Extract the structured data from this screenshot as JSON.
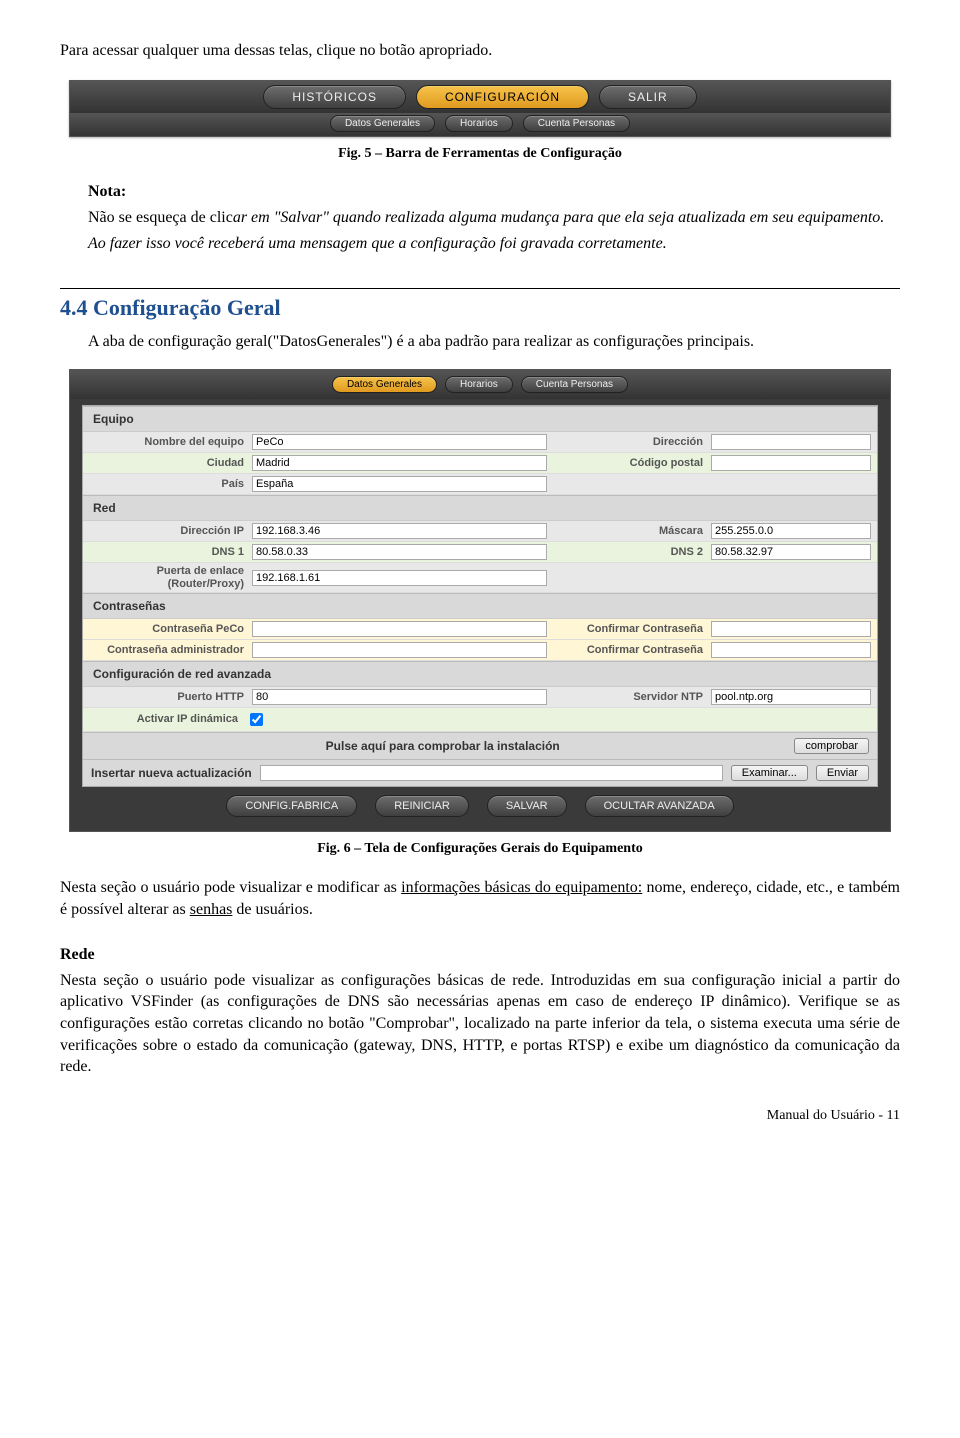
{
  "intro_text": "Para acessar qualquer uma dessas telas, clique no botão apropriado.",
  "toolbar": {
    "main_tabs": [
      "HISTÓRICOS",
      "CONFIGURACIÓN",
      "SALIR"
    ],
    "active_main": 1,
    "sub_tabs": [
      "Datos Generales",
      "Horarios",
      "Cuenta Personas"
    ]
  },
  "fig5_caption": "Fig. 5 – Barra de Ferramentas de Configuração",
  "nota": {
    "label": "Nota:",
    "line1_plain_a": "Não se esqueça de clic",
    "line1_italic_a": "ar em \"Salvar\" quando realizada alguma mudança para que ela seja atualizada em seu equipamento.",
    "line2_italic": "Ao fazer isso você receberá uma mensagem que a configuração foi gravada corretamente."
  },
  "section_44": {
    "title": "4.4  Configuração Geral",
    "para": "A aba de configuração geral(\"DatosGenerales\") é a aba padrão para realizar as configurações principais."
  },
  "config": {
    "sub_tabs": [
      "Datos Generales",
      "Horarios",
      "Cuenta Personas"
    ],
    "active_sub": 0,
    "groups": {
      "equipo": {
        "header": "Equipo",
        "nombre_label": "Nombre del equipo",
        "nombre_value": "PeCo",
        "direccion_label": "Dirección",
        "direccion_value": "",
        "ciudad_label": "Ciudad",
        "ciudad_value": "Madrid",
        "cp_label": "Código postal",
        "cp_value": "",
        "pais_label": "País",
        "pais_value": "España"
      },
      "red": {
        "header": "Red",
        "ip_label": "Dirección IP",
        "ip_value": "192.168.3.46",
        "mask_label": "Máscara",
        "mask_value": "255.255.0.0",
        "dns1_label": "DNS 1",
        "dns1_value": "80.58.0.33",
        "dns2_label": "DNS 2",
        "dns2_value": "80.58.32.97",
        "gw_label": "Puerta de enlace (Router/Proxy)",
        "gw_value": "192.168.1.61"
      },
      "contrasenas": {
        "header": "Contraseñas",
        "peco_label": "Contraseña PeCo",
        "peco_value": "",
        "peco_confirm_label": "Confirmar Contraseña",
        "peco_confirm_value": "",
        "admin_label": "Contraseña administrador",
        "admin_value": "",
        "admin_confirm_label": "Confirmar Contraseña",
        "admin_confirm_value": ""
      },
      "avanzada": {
        "header": "Configuración de red avanzada",
        "http_label": "Puerto HTTP",
        "http_value": "80",
        "ntp_label": "Servidor NTP",
        "ntp_value": "pool.ntp.org",
        "dynip_label": "Activar IP dinámica",
        "dynip_checked": true,
        "install_msg": "Pulse aquí para comprobar la instalación",
        "comprobar_btn": "comprobar",
        "update_label": "Insertar nueva actualización",
        "update_value": "",
        "examinar_btn": "Examinar...",
        "enviar_btn": "Enviar"
      }
    },
    "bottom_buttons": [
      "CONFIG.FABRICA",
      "REINICIAR",
      "SALVAR",
      "OCULTAR AVANZADA"
    ]
  },
  "fig6_caption": "Fig. 6 – Tela de Configurações Gerais do Equipamento",
  "para_after_fig6": {
    "a": "Nesta seção o usuário pode visualizar e modificar as ",
    "u1": "informações básicas do equipamento:",
    "b": " nome, endereço, cidade, etc., e também é possível alterar as ",
    "u2": "senhas",
    "c": " de usuários."
  },
  "rede_section": {
    "title": "Rede",
    "body": "Nesta seção o usuário pode visualizar as configurações básicas de rede. Introduzidas em sua configuração inicial a partir do aplicativo VSFinder (as configurações de DNS são necessárias apenas em caso de endereço IP dinâmico). Verifique se as configurações estão corretas clicando no botão \"Comprobar\", localizado na parte inferior da tela, o sistema executa uma série de verificações sobre o estado da comunicação (gateway, DNS, HTTP, e portas RTSP) e exibe um diagnóstico da comunicação da rede."
  },
  "footer": "Manual do Usuário - 11"
}
